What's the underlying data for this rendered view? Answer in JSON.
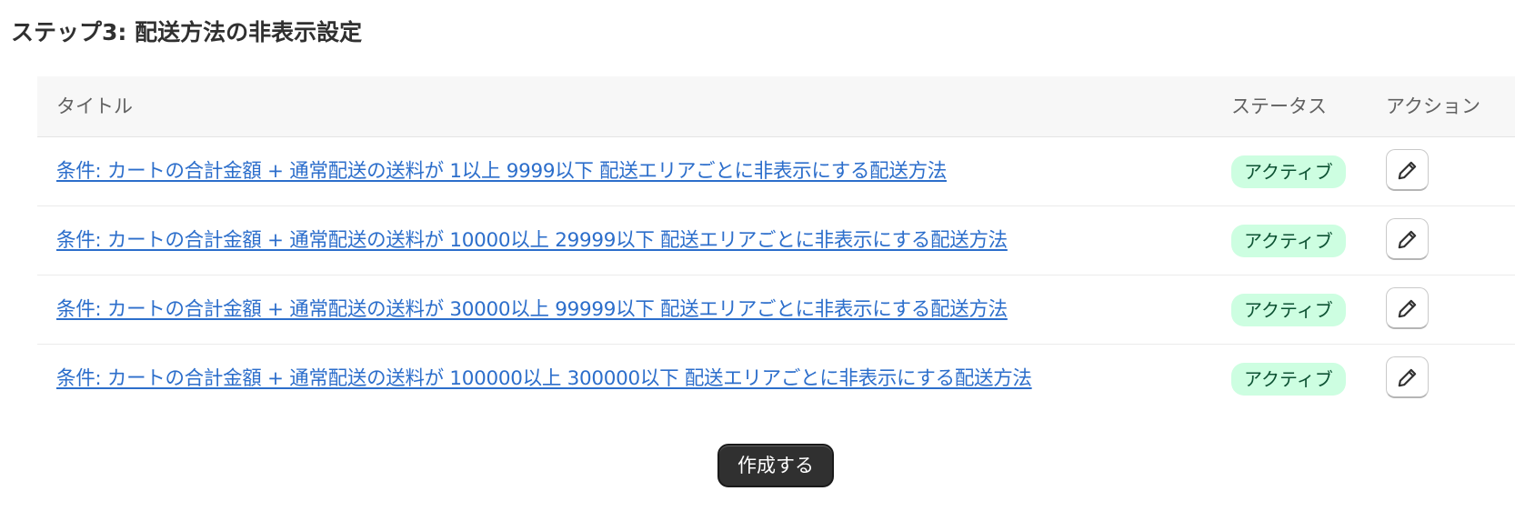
{
  "section": {
    "title": "ステップ3: 配送方法の非表示設定"
  },
  "table": {
    "headers": {
      "title": "タイトル",
      "status": "ステータス",
      "action": "アクション"
    },
    "rows": [
      {
        "title": "条件: カートの合計金額 + 通常配送の送料が 1以上 9999以下 配送エリアごとに非表示にする配送方法",
        "status": "アクティブ",
        "action_icon": "pencil-icon"
      },
      {
        "title": "条件: カートの合計金額 + 通常配送の送料が 10000以上 29999以下 配送エリアごとに非表示にする配送方法",
        "status": "アクティブ",
        "action_icon": "pencil-icon"
      },
      {
        "title": "条件: カートの合計金額 + 通常配送の送料が 30000以上 99999以下 配送エリアごとに非表示にする配送方法",
        "status": "アクティブ",
        "action_icon": "pencil-icon"
      },
      {
        "title": "条件: カートの合計金額 + 通常配送の送料が 100000以上 300000以下 配送エリアごとに非表示にする配送方法",
        "status": "アクティブ",
        "action_icon": "pencil-icon"
      }
    ]
  },
  "actions": {
    "create_label": "作成する"
  },
  "colors": {
    "link": "#2c6ecb",
    "badge_bg": "#cdfee1",
    "badge_text": "#0c5132",
    "primary_button": "#303030",
    "header_bg": "#f7f7f7"
  }
}
